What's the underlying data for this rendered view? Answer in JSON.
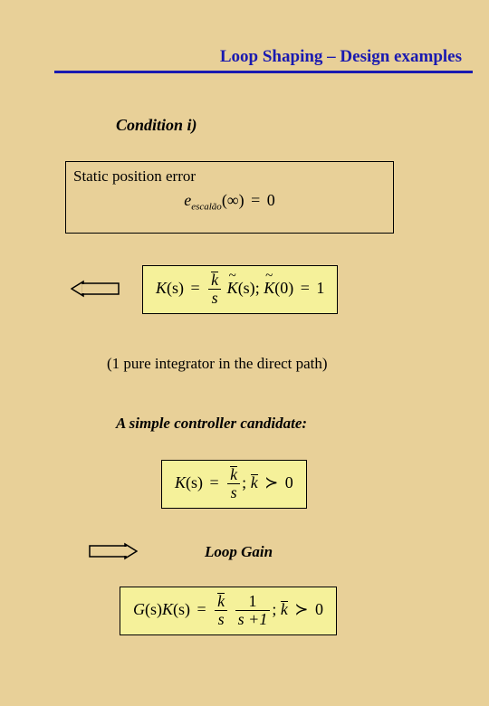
{
  "header": {
    "title": "Loop Shaping – Design examples"
  },
  "condition": {
    "label": "Condition  i)"
  },
  "static_box": {
    "label": "Static position error",
    "eq": {
      "sym": "e",
      "sub": "escalão",
      "arg": "(∞)",
      "eq": "=",
      "rhs": "0"
    }
  },
  "ks_box": {
    "lhs": "K",
    "arg1": "(s)",
    "eq": "=",
    "frac_num_bar": "k",
    "frac_den": "s",
    "Ktilde1": "K",
    "arg2": "(s)",
    "sep": ";",
    "Ktilde2": "K",
    "arg3": "(0)",
    "eq2": "=",
    "rhs": "1"
  },
  "note": {
    "text": "(1 pure integrator in the direct path)"
  },
  "candidate": {
    "label": "A simple controller candidate:"
  },
  "simple_box": {
    "lhs": "K",
    "arg1": "(s)",
    "eq": "=",
    "frac_num_bar": "k",
    "frac_den": "s",
    "sep": ";",
    "kbar": "k",
    "succ": "≻",
    "zero": "0"
  },
  "loopgain": {
    "label": "Loop Gain"
  },
  "gk_box": {
    "G": "G",
    "argG": "(s)",
    "K": "K",
    "argK": "(s)",
    "eq": "=",
    "frac1_num_bar": "k",
    "frac1_den": "s",
    "frac2_num": "1",
    "frac2_den": "s +1",
    "sep": ";",
    "kbar": "k",
    "succ": "≻",
    "zero": "0"
  }
}
